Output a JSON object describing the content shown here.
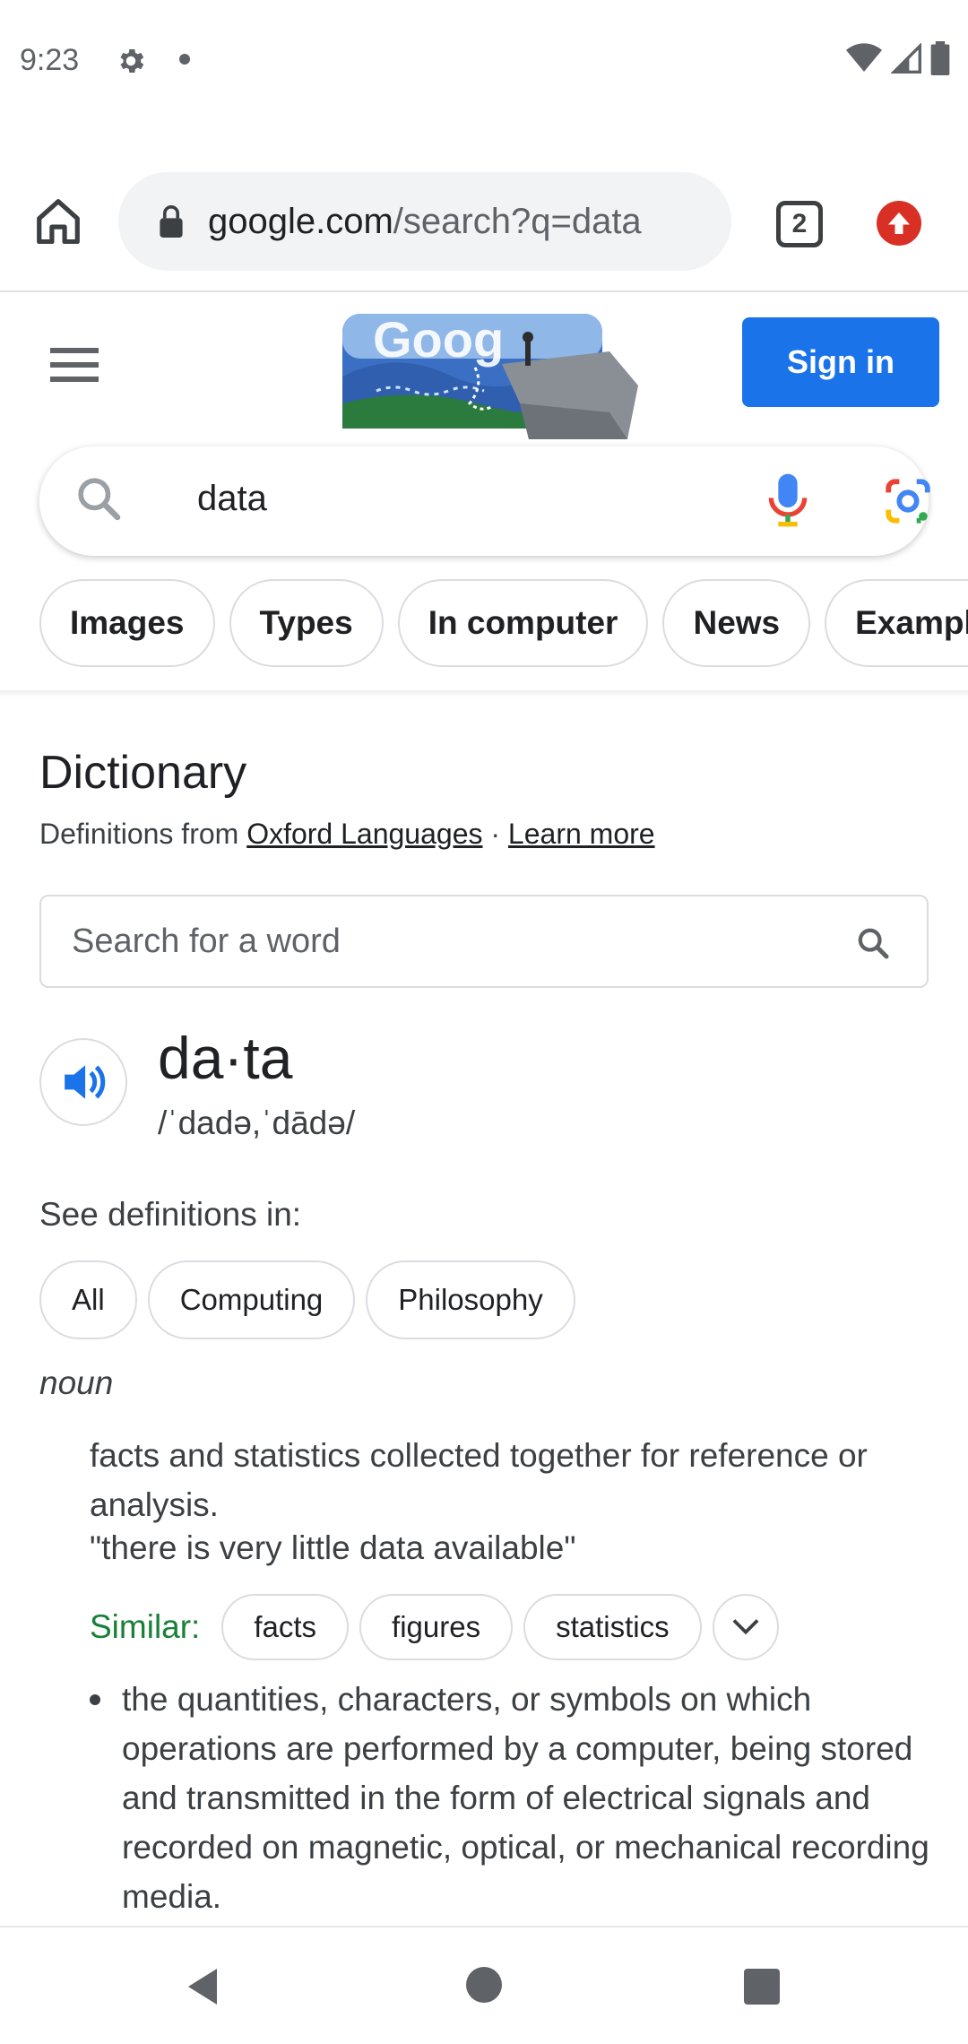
{
  "status_bar": {
    "time": "9:23"
  },
  "browser": {
    "url_domain": "google.com",
    "url_path": "/search?q=data",
    "tab_count": "2"
  },
  "header": {
    "sign_in_label": "Sign in"
  },
  "search": {
    "query": "data"
  },
  "chips": [
    "Images",
    "Types",
    "In computer",
    "News",
    "Examples"
  ],
  "dictionary": {
    "title": "Dictionary",
    "source_prefix": "Definitions from ",
    "source_link": "Oxford Languages",
    "separator": " · ",
    "learn_more": "Learn more",
    "word_search_placeholder": "Search for a word",
    "headword": "da·ta",
    "pronunciation": "/ˈdadə,ˈdādə/",
    "see_definitions_label": "See definitions in:",
    "definition_chips": [
      "All",
      "Computing",
      "Philosophy"
    ],
    "part_of_speech": "noun",
    "definition_1": "facts and statistics collected together for reference or analysis.",
    "example_1": "\"there is very little data available\"",
    "similar_label": "Similar:",
    "similar_words": [
      "facts",
      "figures",
      "statistics"
    ],
    "definition_2": "the quantities, characters, or symbols on which operations are performed by a computer, being stored and transmitted in the form of electrical signals and recorded on magnetic, optical, or mechanical recording media."
  },
  "colors": {
    "brand_blue": "#1a73e8",
    "similar_green": "#188038",
    "update_red": "#d93025"
  }
}
